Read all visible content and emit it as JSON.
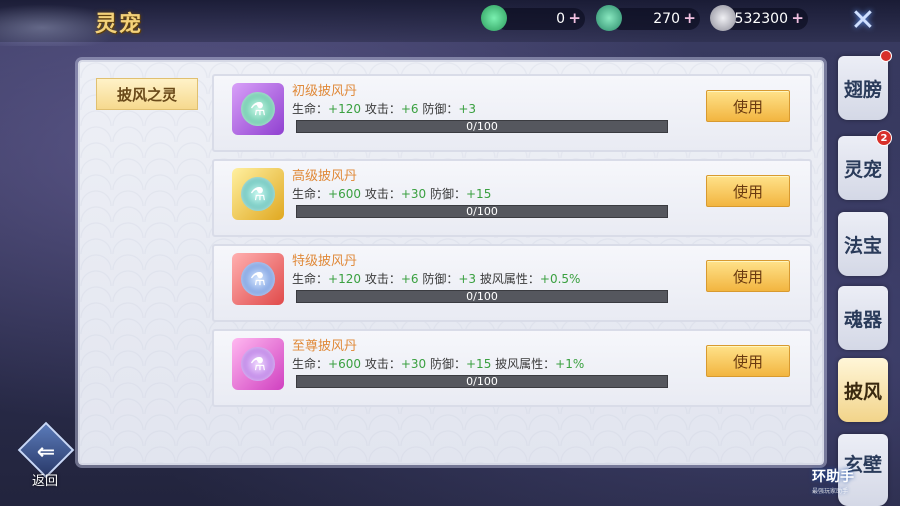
{
  "header": {
    "title": "灵宠",
    "currencies": [
      {
        "icon": "jade-dragon-icon",
        "value": "0",
        "color": "#3ac07a"
      },
      {
        "icon": "jade-coin-stack-icon",
        "value": "270",
        "color": "#3ab07a"
      },
      {
        "icon": "silver-coin-icon",
        "value": "532300",
        "color": "#c8c8d0"
      }
    ],
    "close_icon": "close-icon"
  },
  "category_tab": "披风之灵",
  "items": [
    {
      "name": "初级披风丹",
      "stats": [
        {
          "label": "生命：",
          "value": "+120"
        },
        {
          "label": "攻击：",
          "value": "+6"
        },
        {
          "label": "防御：",
          "value": "+3"
        }
      ],
      "progress_text": "0/100",
      "progress": 0,
      "button": "使用",
      "icon": "cape-pill-icon",
      "frame_color": "#b070e0",
      "orb_color": "#4ac89a"
    },
    {
      "name": "高级披风丹",
      "stats": [
        {
          "label": "生命：",
          "value": "+600"
        },
        {
          "label": "攻击：",
          "value": "+30"
        },
        {
          "label": "防御：",
          "value": "+15"
        }
      ],
      "progress_text": "0/100",
      "progress": 0,
      "button": "使用",
      "icon": "cape-pill-icon",
      "frame_color": "#f0c040",
      "orb_color": "#4ac0b0"
    },
    {
      "name": "特级披风丹",
      "stats": [
        {
          "label": "生命：",
          "value": "+120"
        },
        {
          "label": "攻击：",
          "value": "+6"
        },
        {
          "label": "防御：",
          "value": "+3"
        },
        {
          "label": "披风属性：",
          "value": "+0.5%"
        }
      ],
      "progress_text": "0/100",
      "progress": 0,
      "button": "使用",
      "icon": "cape-pill-icon",
      "frame_color": "#f07070",
      "orb_color": "#5a8ae0"
    },
    {
      "name": "至尊披风丹",
      "stats": [
        {
          "label": "生命：",
          "value": "+600"
        },
        {
          "label": "攻击：",
          "value": "+30"
        },
        {
          "label": "防御：",
          "value": "+15"
        },
        {
          "label": "披风属性：",
          "value": "+1%"
        }
      ],
      "progress_text": "0/100",
      "progress": 0,
      "button": "使用",
      "icon": "cape-pill-icon",
      "frame_color": "#e870d8",
      "orb_color": "#c070e0"
    }
  ],
  "side_tabs": [
    {
      "label": "翅膀",
      "badge": ""
    },
    {
      "label": "灵宠",
      "badge": "2"
    },
    {
      "label": "法宝",
      "badge": ""
    },
    {
      "label": "魂器",
      "badge": ""
    },
    {
      "label": "披风",
      "badge": "",
      "active": true
    },
    {
      "label": "玄壁",
      "badge": ""
    }
  ],
  "back_label": "返回",
  "watermark": {
    "main": "环助手",
    "sub": "最强玩家助手"
  }
}
